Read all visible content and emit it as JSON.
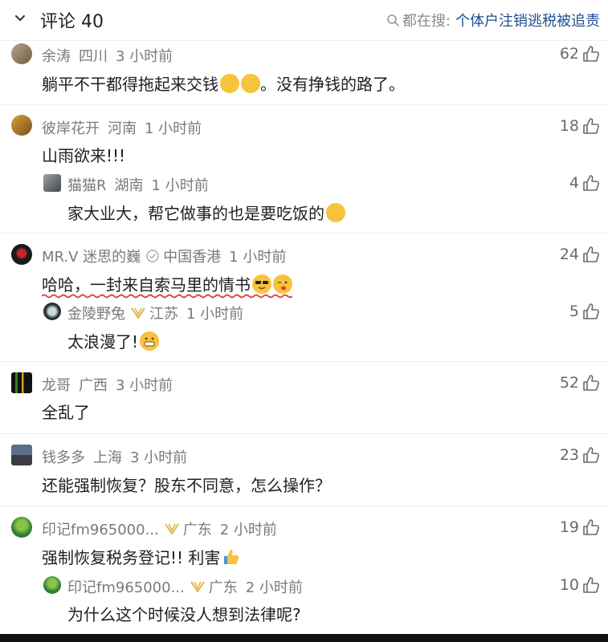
{
  "header": {
    "title": "评论 40",
    "search_prefix": "都在搜:",
    "search_term": "个体户注销逃税被追责",
    "icons": {
      "collapse": "chevron-down-icon",
      "search": "search-icon"
    }
  },
  "comments": [
    {
      "user": "余涛",
      "location": "四川",
      "time": "3 小时前",
      "text": "躺平不干都得拖起来交钱",
      "text2": "。没有挣钱的路了。",
      "emojis": [
        "laugh-cry",
        "laugh-cry"
      ],
      "likes": "62"
    },
    {
      "user": "彼岸花开",
      "location": "河南",
      "time": "1 小时前",
      "text": "山雨欲来!!!",
      "likes": "18",
      "reply": {
        "user": "猫猫R",
        "location": "湖南",
        "time": "1 小时前",
        "text": "家大业大，帮它做事的也是要吃饭的",
        "emojis": [
          "laugh-cry"
        ],
        "likes": "4"
      }
    },
    {
      "user": "MR.V 迷思的巍",
      "location": "中国香港",
      "time": "1 小时前",
      "text": "哈哈，一封来自索马里的情书",
      "emojis": [
        "sunglasses",
        "wink-tongue"
      ],
      "likes": "24",
      "verified_icon": "verified-icon",
      "reply": {
        "user": "金陵野兔",
        "location": "江苏",
        "time": "1 小时前",
        "text": "太浪漫了!",
        "emojis": [
          "grin"
        ],
        "likes": "5",
        "badge_icon": "vip-badge-icon"
      }
    },
    {
      "user": "龙哥",
      "location": "广西",
      "time": "3 小时前",
      "text": "全乱了",
      "likes": "52"
    },
    {
      "user": "钱多多",
      "location": "上海",
      "time": "3 小时前",
      "text": "还能强制恢复？股东不同意，怎么操作？",
      "likes": "23"
    },
    {
      "user": "印记fm965000...",
      "location": "广东",
      "time": "2 小时前",
      "text": "强制恢复税务登记!! 利害",
      "emojis": [
        "thumbs-up"
      ],
      "likes": "19",
      "badge_icon": "vip-badge-icon",
      "reply": {
        "user": "印记fm965000...",
        "location": "广东",
        "time": "2 小时前",
        "text": "为什么这个时候没人想到法律呢?",
        "likes": "10",
        "badge_icon": "vip-badge-icon"
      }
    }
  ],
  "colors": {
    "meta": "#7a7a7a",
    "search_term": "#1d4f91",
    "badge": "#e0b44a",
    "underline": "#e53935"
  }
}
